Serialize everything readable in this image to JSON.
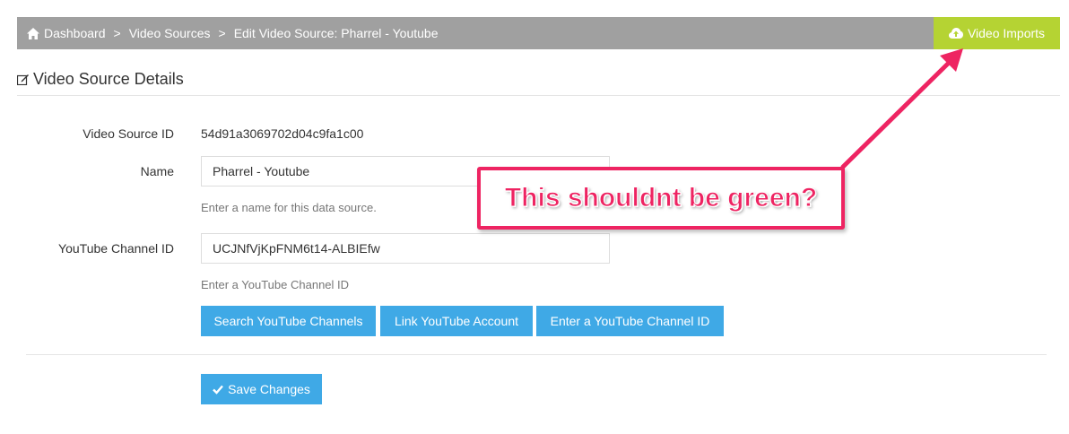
{
  "breadcrumb": {
    "items": [
      "Dashboard",
      "Video Sources",
      "Edit Video Source: Pharrel - Youtube"
    ],
    "separator": ">"
  },
  "header": {
    "imports_label": "Video Imports",
    "imports_color": "#b5d333"
  },
  "section": {
    "title": "Video Source Details"
  },
  "form": {
    "id_label": "Video Source ID",
    "id_value": "54d91a3069702d04c9fa1c00",
    "name_label": "Name",
    "name_value": "Pharrel - Youtube",
    "name_help": "Enter a name for this data source.",
    "channel_label": "YouTube Channel ID",
    "channel_value": "UCJNfVjKpFNM6t14-ALBIEfw",
    "channel_help": "Enter a YouTube Channel ID",
    "buttons": [
      "Search YouTube Channels",
      "Link YouTube Account",
      "Enter a YouTube Channel ID"
    ],
    "save_label": "Save Changes"
  },
  "annotation": {
    "text": "This shouldnt be green?",
    "color": "#ee2462"
  },
  "colors": {
    "breadcrumb_bg": "#a0a0a0",
    "button_blue": "#3fa9e6"
  }
}
